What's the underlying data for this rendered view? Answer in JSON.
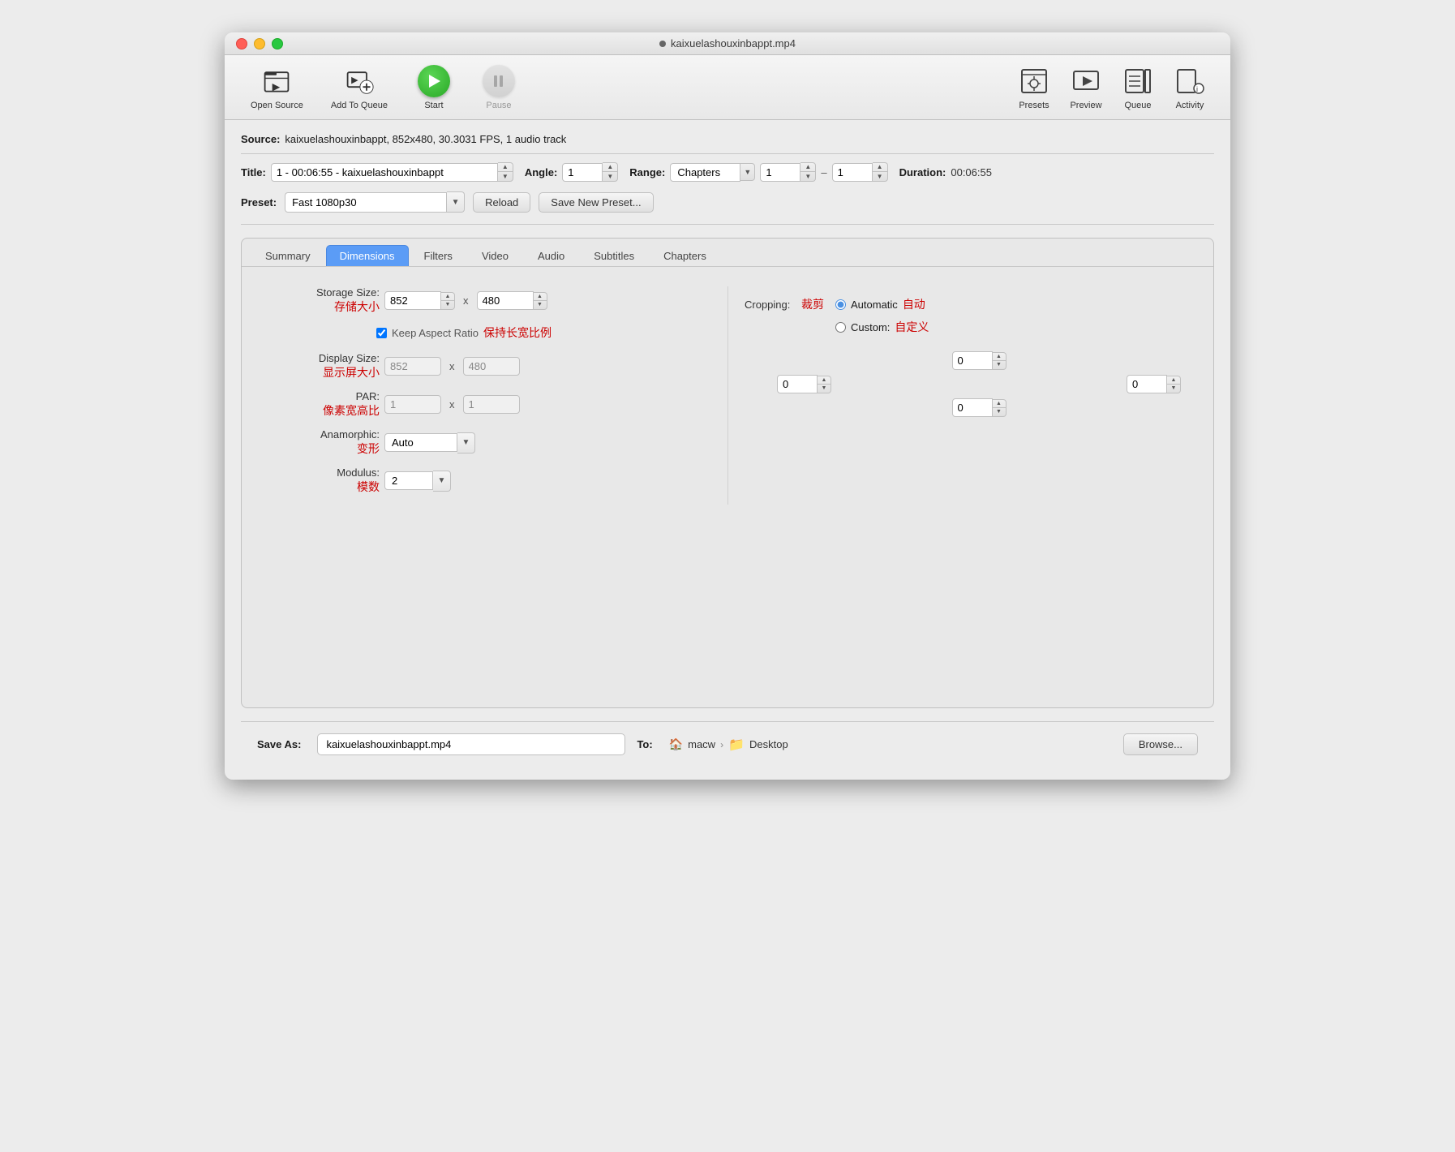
{
  "titlebar": {
    "title": "kaixuelashouxinbappt.mp4"
  },
  "toolbar": {
    "open_source_label": "Open Source",
    "add_to_queue_label": "Add To Queue",
    "start_label": "Start",
    "pause_label": "Pause",
    "presets_label": "Presets",
    "preview_label": "Preview",
    "queue_label": "Queue",
    "activity_label": "Activity"
  },
  "source": {
    "label": "Source:",
    "value": "kaixuelashouxinbappt, 852x480, 30.3031 FPS, 1 audio track"
  },
  "title_field": {
    "label": "Title:",
    "value": "1 - 00:06:55 - kaixuelashouxinbappt"
  },
  "angle_field": {
    "label": "Angle:",
    "value": "1"
  },
  "range_field": {
    "label": "Range:",
    "select_value": "Chapters",
    "from": "1",
    "to": "1"
  },
  "duration_field": {
    "label": "Duration:",
    "value": "00:06:55"
  },
  "preset_field": {
    "label": "Preset:",
    "value": "Fast 1080p30",
    "reload_label": "Reload",
    "save_new_label": "Save New Preset..."
  },
  "tabs": {
    "items": [
      {
        "label": "Summary",
        "active": false
      },
      {
        "label": "Dimensions",
        "active": true
      },
      {
        "label": "Filters",
        "active": false
      },
      {
        "label": "Video",
        "active": false
      },
      {
        "label": "Audio",
        "active": false
      },
      {
        "label": "Subtitles",
        "active": false
      },
      {
        "label": "Chapters",
        "active": false
      }
    ]
  },
  "dimensions": {
    "storage_size": {
      "label": "Storage Size:",
      "label_cn": "存储大小",
      "width": "852",
      "height": "480"
    },
    "keep_aspect_ratio": {
      "label": "Keep Aspect Ratio",
      "label_cn": "保持长宽比例",
      "checked": true
    },
    "display_size": {
      "label": "Display Size:",
      "label_cn": "显示屏大小",
      "width": "852",
      "height": "480"
    },
    "par": {
      "label": "PAR:",
      "label_cn": "像素宽高比",
      "x": "1",
      "y": "1"
    },
    "anamorphic": {
      "label": "Anamorphic:",
      "label_cn": "变形",
      "value": "Auto"
    },
    "modulus": {
      "label": "Modulus:",
      "label_cn": "模数",
      "value": "2"
    },
    "cropping": {
      "label": "Cropping:",
      "label_cn": "裁剪",
      "automatic": {
        "label": "Automatic",
        "label_cn": "自动",
        "selected": true
      },
      "custom": {
        "label": "Custom:",
        "label_cn": "自定义",
        "selected": false
      }
    },
    "crop_top": "0",
    "crop_bottom": "0",
    "crop_left": "0",
    "crop_right": "0"
  },
  "bottom": {
    "save_as_label": "Save As:",
    "filename": "kaixuelashouxinbappt.mp4",
    "to_label": "To:",
    "user": "macw",
    "folder": "Desktop",
    "browse_label": "Browse..."
  }
}
